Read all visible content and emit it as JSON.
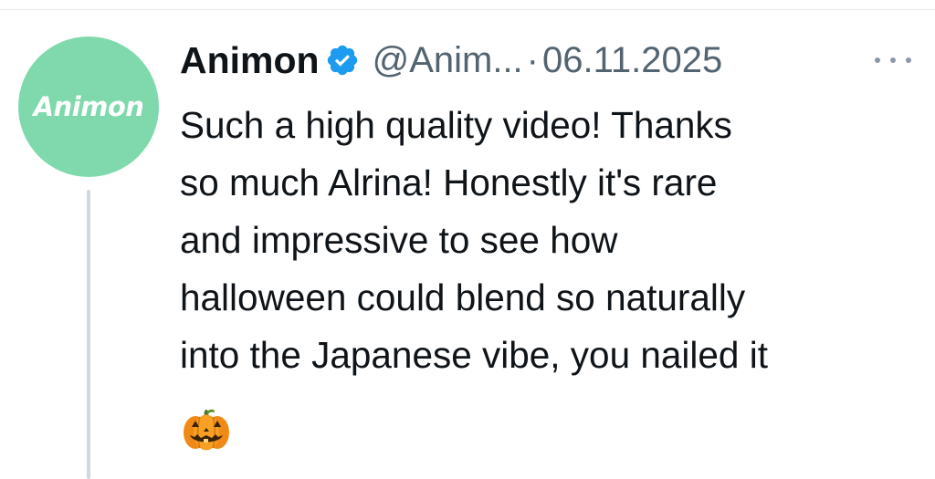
{
  "tweet": {
    "author_name": "Animon",
    "author_handle": "@Anim...",
    "separator": "·",
    "date": "06.11.2025",
    "avatar_label": "Animon",
    "verified": true,
    "body_lines": [
      "Such a high quality video! Thanks",
      "so much Alrina! Honestly it's rare",
      "and impressive to see how",
      "halloween could blend so naturally",
      "into the Japanese vibe, you nailed it"
    ],
    "emoji": "jack-o-lantern",
    "more_icon": "ellipsis-icon"
  },
  "colors": {
    "avatar_bg": "#7fd9ac",
    "verified_blue": "#1d9bf0",
    "text_primary": "#0f1419",
    "text_secondary": "#536471",
    "thread_line": "#cfd9de"
  }
}
